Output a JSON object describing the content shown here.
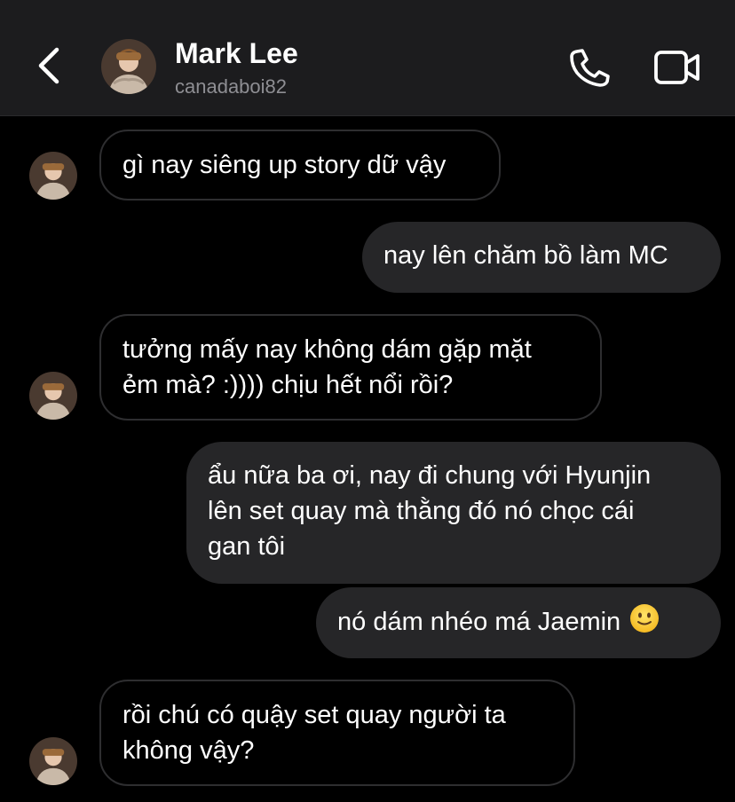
{
  "header": {
    "name": "Mark Lee",
    "handle": "canadaboi82"
  },
  "icons": {
    "back": "chevron-left-icon",
    "call": "phone-icon",
    "video": "video-camera-icon"
  },
  "colors": {
    "header_bg": "#1c1c1e",
    "background": "#000000",
    "outgoing_bubble": "#262628",
    "incoming_border": "#2e2e30",
    "secondary_text": "#8e8e93"
  },
  "messages": [
    {
      "direction": "incoming",
      "text": "gì nay siêng up story dữ vậy"
    },
    {
      "direction": "outgoing",
      "text": "nay lên chăm bồ làm MC"
    },
    {
      "direction": "incoming",
      "lines": [
        "tưởng mấy nay không dám gặp mặt",
        "ẻm mà? :)))) chịu hết nổi rồi?"
      ]
    },
    {
      "direction": "outgoing",
      "lines": [
        "ẩu nữa ba ơi, nay đi chung với Hyunjin",
        "lên set quay mà thằng đó nó chọc cái",
        "gan tôi"
      ]
    },
    {
      "direction": "outgoing",
      "text": "nó dám nhéo má Jaemin",
      "emoji": "slightly-smiling-face"
    },
    {
      "direction": "incoming",
      "lines": [
        "rồi chú có quậy set quay người ta",
        "không vậy?"
      ]
    }
  ]
}
